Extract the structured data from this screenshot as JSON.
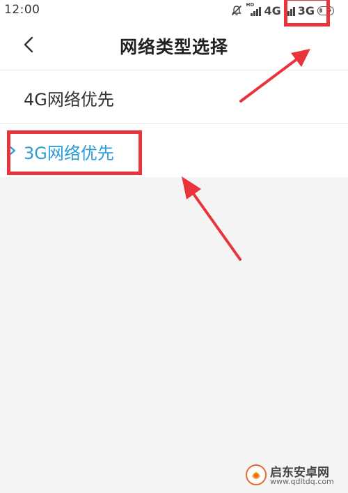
{
  "status_bar": {
    "time": "12:00",
    "network_1": "4G",
    "network_2": "3G",
    "signal_badge": "HD",
    "battery_level": "5"
  },
  "header": {
    "title": "网络类型选择",
    "back_icon": "chevron-left-icon"
  },
  "options": [
    {
      "label": "4G网络优先",
      "selected": false
    },
    {
      "label": "3G网络优先",
      "selected": true
    }
  ],
  "watermark": {
    "title": "启东安卓网",
    "url": "www.qdltdq.com"
  },
  "colors": {
    "accent": "#2b9cd8",
    "annotation": "#e8343a",
    "background": "#f4f4f4"
  }
}
